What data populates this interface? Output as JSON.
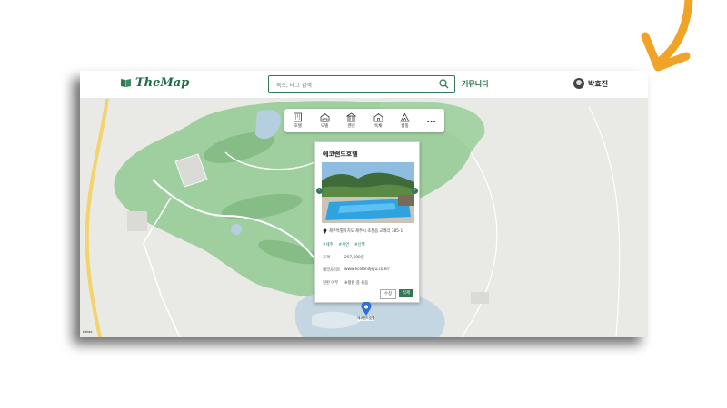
{
  "header": {
    "logo_text": "TheMap",
    "search_placeholder": "숙소, 태그 검색",
    "community_label": "커뮤니티",
    "user_name": "박효진"
  },
  "categories": [
    {
      "label": "호텔",
      "icon": "hotel-icon"
    },
    {
      "label": "모텔",
      "icon": "motel-icon"
    },
    {
      "label": "펜션",
      "icon": "pension-icon"
    },
    {
      "label": "독채",
      "icon": "house-icon"
    },
    {
      "label": "캠핑",
      "icon": "tent-icon"
    }
  ],
  "more_label": "...",
  "card": {
    "title": "에코랜드호텔",
    "address": "제주특별자치도 제주시 조천읍 교래리 385-1",
    "tags": [
      "#제주",
      "#자연",
      "#산책"
    ],
    "price_label": "가격",
    "price_value": "297,600원",
    "site_label": "예약사이트",
    "site_value": "www.ecolandjeju.co.kr/",
    "rating_label": "평판 여부",
    "rating_value": "※평판 중 좋음",
    "edit_label": "수정",
    "delete_label": "삭제",
    "prev_arrow": "‹",
    "next_arrow": "›"
  },
  "marker": {
    "label": "에코랜드호텔"
  },
  "map_attribution": "kakao",
  "colors": {
    "brand": "#2f7a55",
    "map_green": "#9ccd9f",
    "arrow": "#f0a326"
  }
}
